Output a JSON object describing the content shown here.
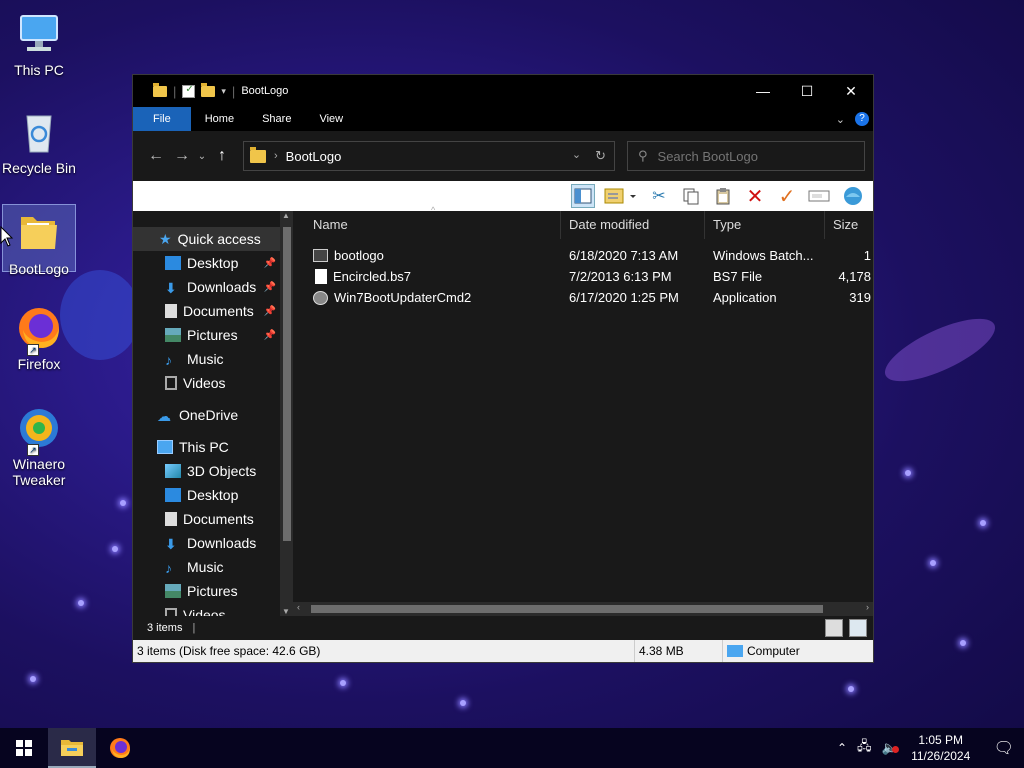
{
  "desktop": {
    "icons": [
      {
        "label": "This PC"
      },
      {
        "label": "Recycle Bin"
      },
      {
        "label": "BootLogo"
      },
      {
        "label": "Firefox"
      },
      {
        "label": "Winaero Tweaker"
      }
    ]
  },
  "window": {
    "title": "BootLogo",
    "tabs": {
      "file": "File",
      "home": "Home",
      "share": "Share",
      "view": "View"
    },
    "address": {
      "crumb": "BootLogo"
    },
    "search": {
      "placeholder": "Search BootLogo"
    },
    "navpane": {
      "quick_access": "Quick access",
      "qa_items": [
        {
          "label": "Desktop"
        },
        {
          "label": "Downloads"
        },
        {
          "label": "Documents"
        },
        {
          "label": "Pictures"
        },
        {
          "label": "Music"
        },
        {
          "label": "Videos"
        }
      ],
      "onedrive": "OneDrive",
      "this_pc": "This PC",
      "pc_items": [
        {
          "label": "3D Objects"
        },
        {
          "label": "Desktop"
        },
        {
          "label": "Documents"
        },
        {
          "label": "Downloads"
        },
        {
          "label": "Music"
        },
        {
          "label": "Pictures"
        },
        {
          "label": "Videos"
        }
      ]
    },
    "columns": {
      "name": "Name",
      "date": "Date modified",
      "type": "Type",
      "size": "Size"
    },
    "files": [
      {
        "name": "bootlogo",
        "date": "6/18/2020 7:13 AM",
        "type": "Windows Batch...",
        "size": "1"
      },
      {
        "name": "Encircled.bs7",
        "date": "7/2/2013 6:13 PM",
        "type": "BS7 File",
        "size": "4,178"
      },
      {
        "name": "Win7BootUpdaterCmd2",
        "date": "6/17/2020 1:25 PM",
        "type": "Application",
        "size": "319"
      }
    ],
    "status": {
      "count": "3 items"
    },
    "infobar": {
      "items": "3 items (Disk free space: 42.6 GB)",
      "size": "4.38 MB",
      "location": "Computer"
    }
  },
  "taskbar": {
    "time": "1:05 PM",
    "date": "11/26/2024"
  }
}
